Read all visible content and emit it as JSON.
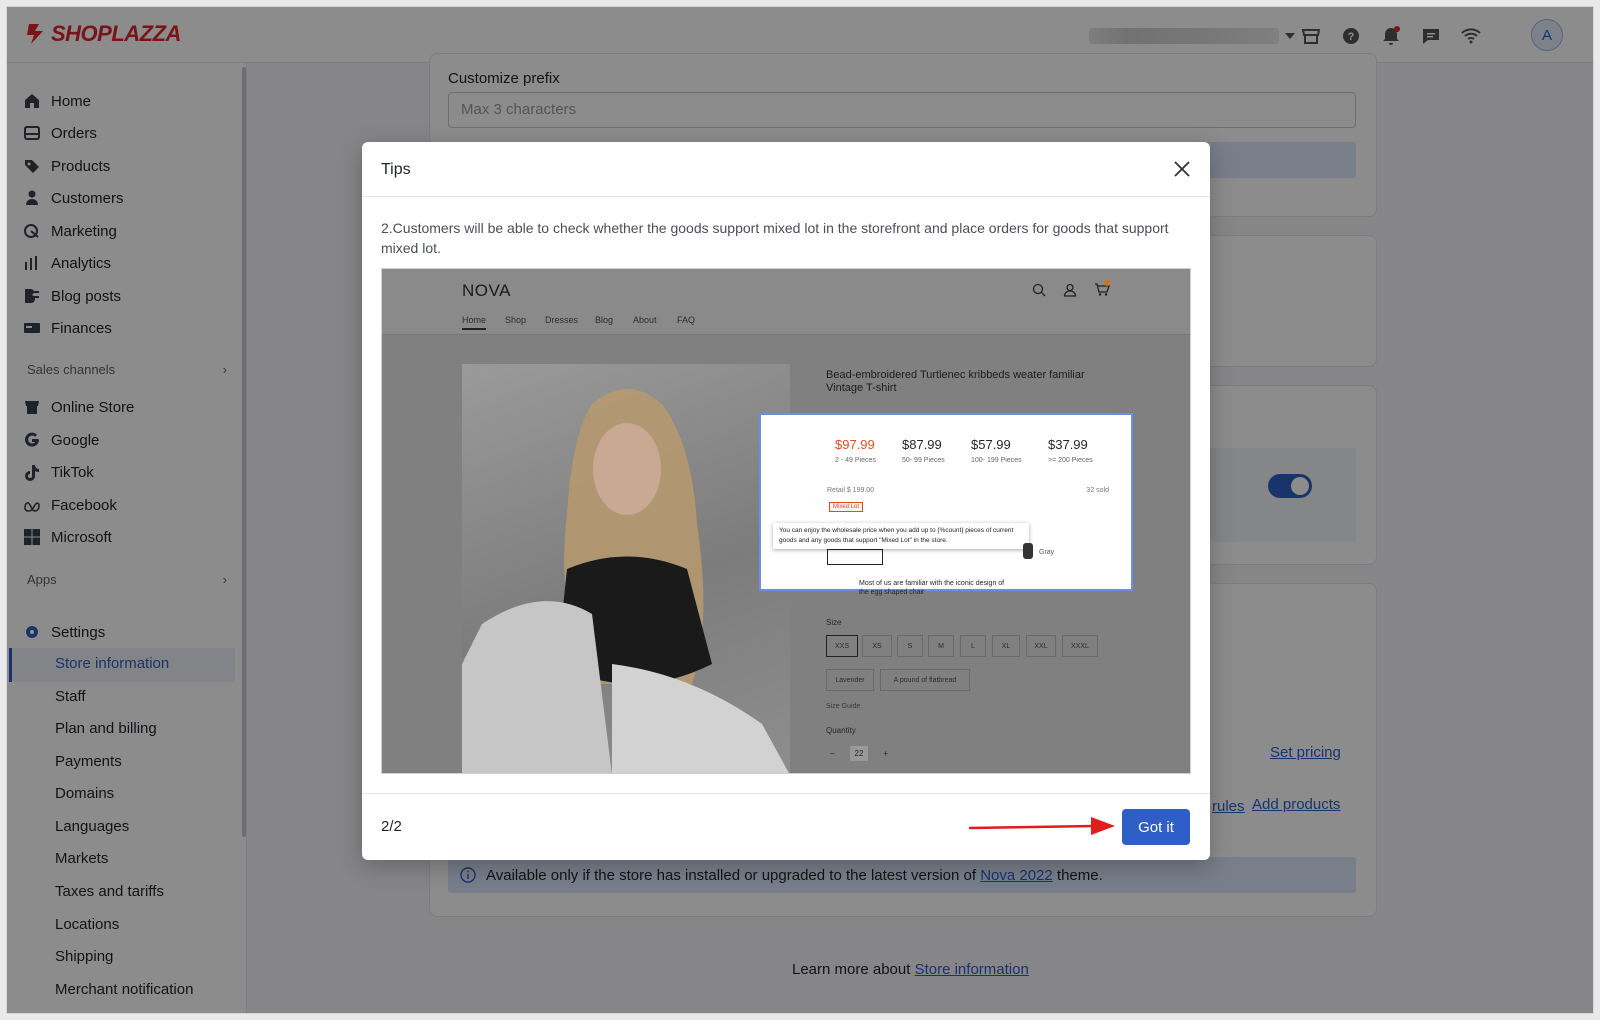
{
  "brand": {
    "name": "SHOPLAZZA",
    "color": "#e0242d",
    "accent": "#2e5ec6"
  },
  "topbar": {
    "icons": [
      "store-icon",
      "help-icon",
      "bell-icon",
      "chat-icon",
      "wifi-icon"
    ],
    "avatar_letter": "A"
  },
  "sidebar": {
    "main_items": [
      {
        "label": "Home",
        "icon": "home-icon"
      },
      {
        "label": "Orders",
        "icon": "orders-icon"
      },
      {
        "label": "Products",
        "icon": "tag-icon"
      },
      {
        "label": "Customers",
        "icon": "person-icon"
      },
      {
        "label": "Marketing",
        "icon": "marketing-icon"
      },
      {
        "label": "Analytics",
        "icon": "bar-chart-icon"
      },
      {
        "label": "Blog posts",
        "icon": "blog-icon"
      },
      {
        "label": "Finances",
        "icon": "finance-icon"
      }
    ],
    "sales_channels_label": "Sales channels",
    "channels": [
      {
        "label": "Online Store",
        "icon": "store-icon"
      },
      {
        "label": "Google",
        "icon": "google-icon"
      },
      {
        "label": "TikTok",
        "icon": "tiktok-icon"
      },
      {
        "label": "Facebook",
        "icon": "meta-icon"
      },
      {
        "label": "Microsoft",
        "icon": "microsoft-icon"
      }
    ],
    "apps_label": "Apps",
    "settings_label": "Settings",
    "settings_items": [
      "Store information",
      "Staff",
      "Plan and billing",
      "Payments",
      "Domains",
      "Languages",
      "Markets",
      "Taxes and tariffs",
      "Locations",
      "Shipping",
      "Merchant notification"
    ],
    "active_item": "Store information"
  },
  "main": {
    "prefix_label": "Customize prefix",
    "prefix_placeholder": "Max 3 characters",
    "set_pricing": "Set pricing",
    "rules_text": "rules",
    "add_products": "Add products",
    "info_prefix": "Available only if the store has installed or upgraded to the latest version of ",
    "info_link": "Nova 2022",
    "info_suffix": " theme.",
    "learn_prefix": "Learn more about ",
    "learn_link": "Store information"
  },
  "modal": {
    "title": "Tips",
    "body": "2.Customers will be able to check whether the goods support mixed lot in the storefront and place orders for goods that support mixed lot.",
    "pager": "2/2",
    "button": "Got it"
  },
  "preview": {
    "store_name": "NOVA",
    "nav": [
      "Home",
      "Shop",
      "Dresses",
      "Blog",
      "About",
      "FAQ"
    ],
    "product_title": "Bead-embroidered Turtlenec kribbeds weater familiar Vintage T-shirt",
    "tiers": [
      {
        "price": "$97.99",
        "range": "2 - 49 Pieces"
      },
      {
        "price": "$87.99",
        "range": "50- 99 Pieces"
      },
      {
        "price": "$57.99",
        "range": "100- 199 Pieces"
      },
      {
        "price": "$37.99",
        "range": ">= 200 Pieces"
      }
    ],
    "retail": "Retail $ 199.00",
    "sold": "32 sold",
    "mixed_lot": "Mixed Lot",
    "tooltip": "You can enjoy the wholesale price when you add up to {%count} pieces of current goods and any goods that support \"Mixed Lot\" in the store.",
    "color_label": "Gray",
    "bundle_text": "Most of us are familiar with the iconic design of the egg shaped chair",
    "size_label": "Size",
    "sizes": [
      "XXS",
      "XS",
      "S",
      "M",
      "L",
      "XL",
      "XXL",
      "XXXL"
    ],
    "options": [
      "Lavender",
      "A pound of flatbread"
    ],
    "size_guide": "Size Guide",
    "quantity_label": "Quantity",
    "quantity": "22"
  }
}
